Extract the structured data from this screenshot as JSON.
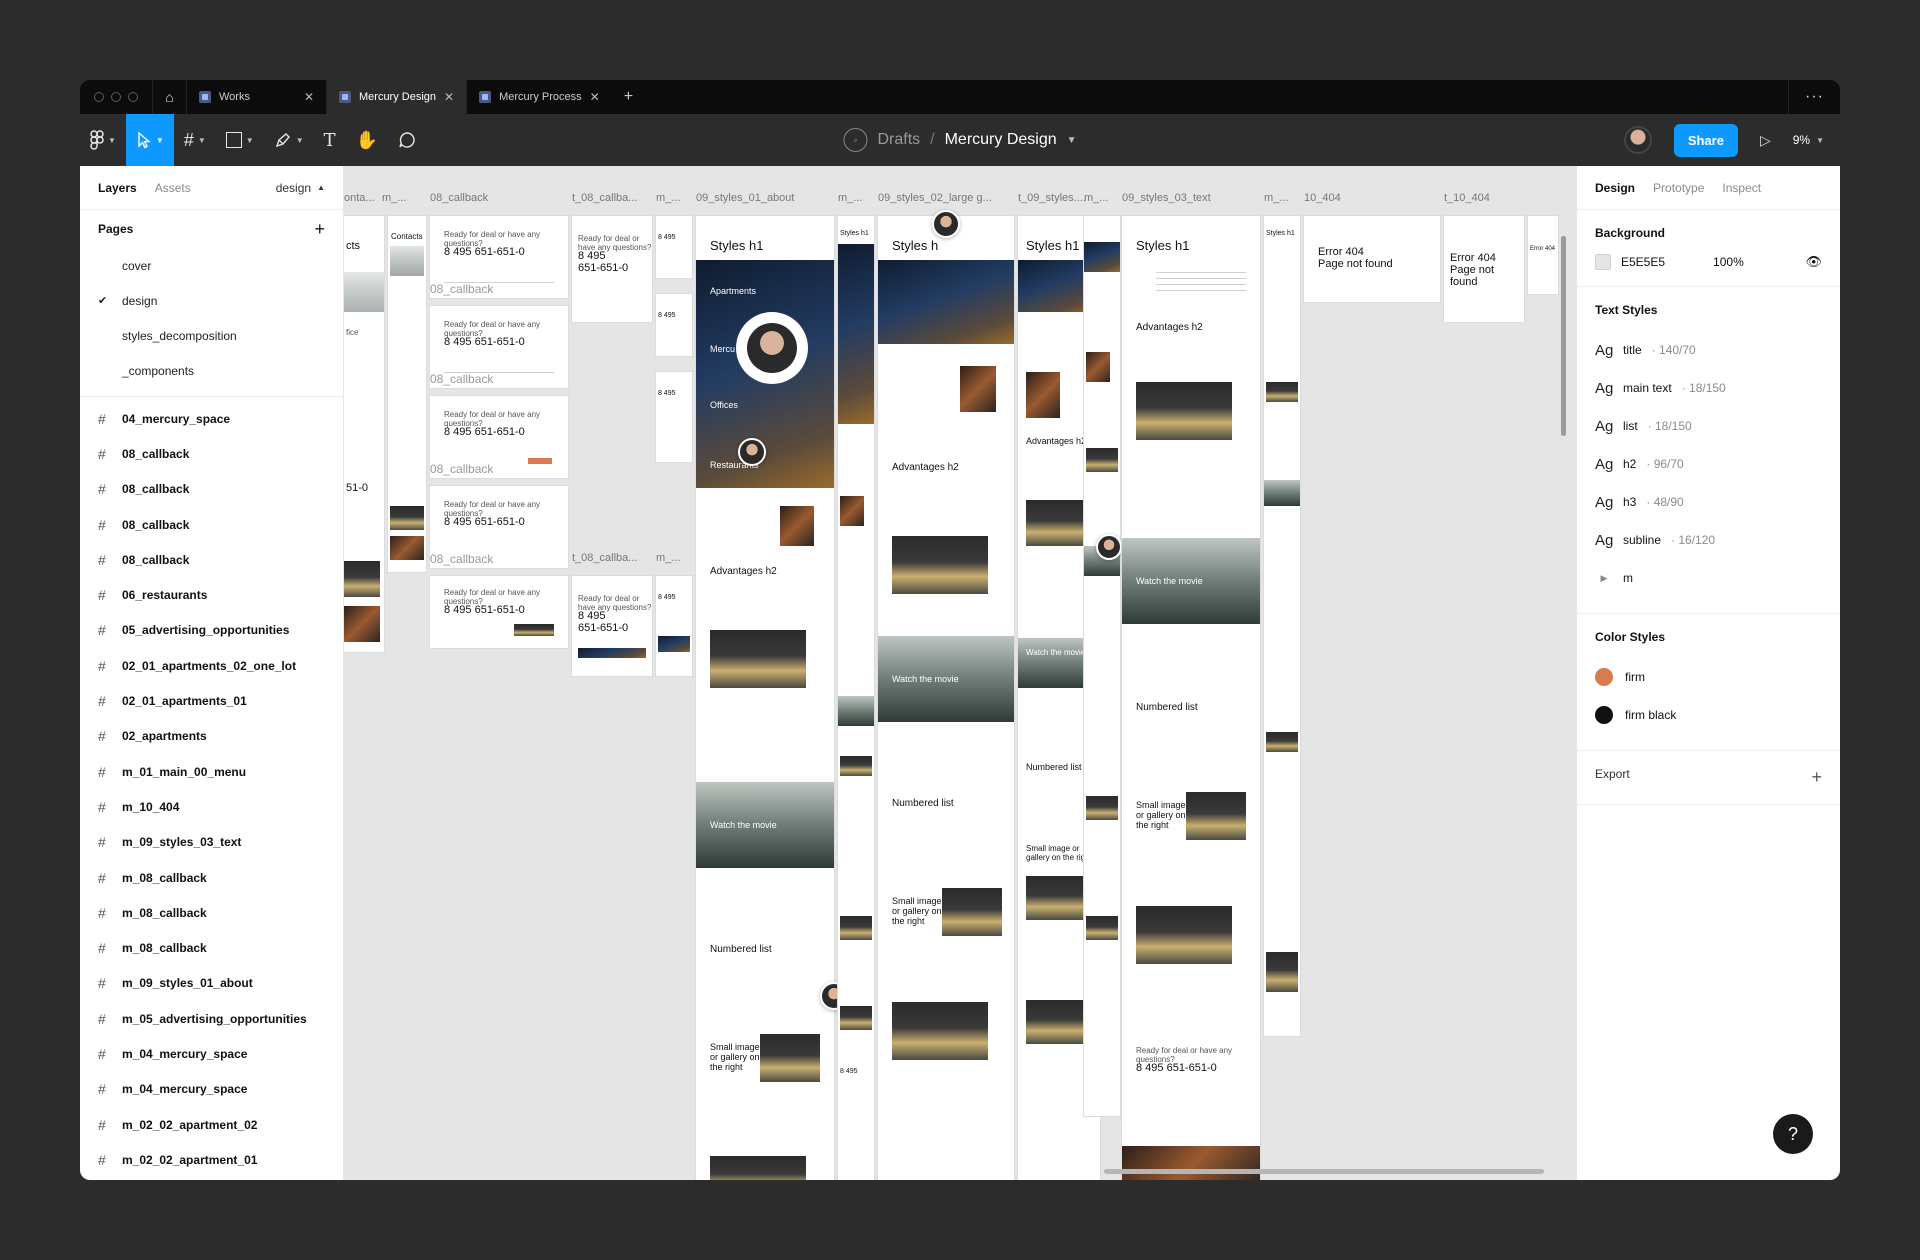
{
  "tabs": [
    {
      "label": "Works",
      "active": false
    },
    {
      "label": "Mercury Design",
      "active": true
    },
    {
      "label": "Mercury Process",
      "active": false
    }
  ],
  "breadcrumb": {
    "parent": "Drafts",
    "separator": "/",
    "file": "Mercury Design"
  },
  "toolbar": {
    "share_label": "Share",
    "zoom": "9%"
  },
  "left_panel": {
    "tabs": {
      "layers": "Layers",
      "assets": "Assets"
    },
    "page_selector": "design",
    "pages_title": "Pages",
    "pages": [
      "cover",
      "design",
      "styles_decomposition",
      "_components"
    ],
    "current_page_index": 1,
    "layers": [
      "04_mercury_space",
      "08_callback",
      "08_callback",
      "08_callback",
      "08_callback",
      "06_restaurants",
      "05_advertising_opportunities",
      "02_01_apartments_02_one_lot",
      "02_01_apartments_01",
      "02_apartments",
      "m_01_main_00_menu",
      "m_10_404",
      "m_09_styles_03_text",
      "m_08_callback",
      "m_08_callback",
      "m_08_callback",
      "m_09_styles_01_about",
      "m_05_advertising_opportunities",
      "m_04_mercury_space",
      "m_04_mercury_space",
      "m_02_02_apartment_02",
      "m_02_02_apartment_01"
    ]
  },
  "canvas": {
    "frame_labels": [
      "onta...",
      "m_...",
      "08_callback",
      "t_08_callba...",
      "m_...",
      "09_styles_01_about",
      "m_...",
      "09_styles_02_large g...",
      "t_09_styles....",
      "m_...",
      "09_styles_03_text",
      "m_...",
      "10_404",
      "t_10_404"
    ],
    "callback_labels": [
      "08_callback",
      "08_callback",
      "08_callback",
      "08_callback",
      "t_08_callba...",
      "m_..."
    ],
    "phone": "8 495 651-651-0",
    "phone_wrap_a": "8 495",
    "phone_wrap_b": "651-651-0",
    "phone_partial": "51-0",
    "styles_h1": "Styles h1",
    "styles_h1_clip": "Styles h",
    "advantages": "Advantages h2",
    "numbered": "Numbered list",
    "small_image": "Small image or gallery on the right",
    "watch": "Watch the movie",
    "error_404": "Error 404",
    "not_found": "Page not found",
    "contacts": "Contacts",
    "contacts_clip": "cts",
    "office_clip": "fice",
    "apartments": "Apartments",
    "offices": "Offices",
    "restaurants": "Restaurants",
    "mercury_clip": "Mercu",
    "ready_text": "Ready for deal or have any questions?"
  },
  "right_panel": {
    "tabs": {
      "design": "Design",
      "prototype": "Prototype",
      "inspect": "Inspect"
    },
    "background": {
      "title": "Background",
      "hex": "E5E5E5",
      "opacity": "100%"
    },
    "text_styles_title": "Text Styles",
    "text_styles": [
      {
        "name": "title",
        "meta": "· 140/70"
      },
      {
        "name": "main text",
        "meta": "· 18/150"
      },
      {
        "name": "list",
        "meta": "· 18/150"
      },
      {
        "name": "h2",
        "meta": "· 96/70"
      },
      {
        "name": "h3",
        "meta": "· 48/90"
      },
      {
        "name": "subline",
        "meta": "· 16/120"
      }
    ],
    "text_style_group": "m",
    "ag_glyph": "Ag",
    "color_styles_title": "Color Styles",
    "color_styles": [
      {
        "name": "firm",
        "color": "#d97b4f"
      },
      {
        "name": "firm black",
        "color": "#111111"
      }
    ],
    "export_label": "Export"
  },
  "help_label": "?"
}
